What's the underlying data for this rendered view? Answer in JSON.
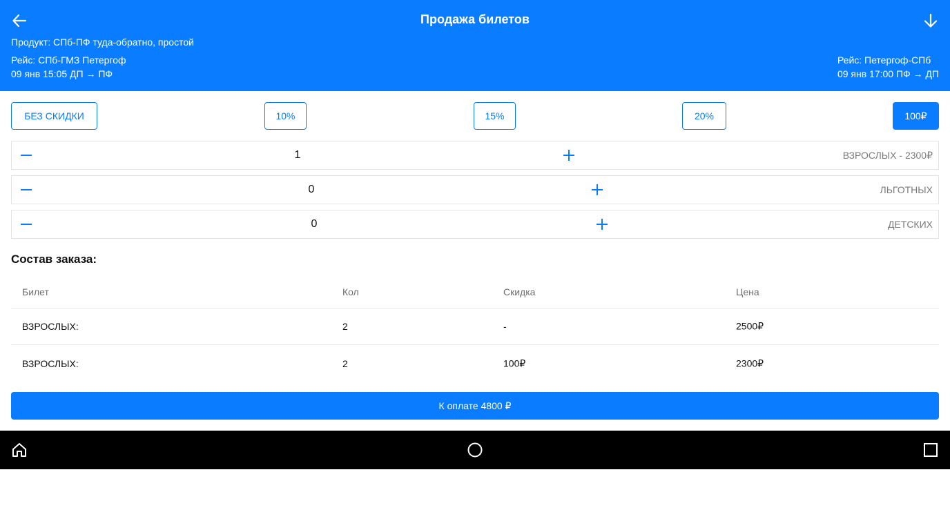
{
  "header": {
    "title": "Продажа билетов",
    "product": "Продукт: СПб-ПФ туда-обратно, простой",
    "outbound": {
      "route": "Рейс: СПб-ГМЗ Петергоф",
      "time": "09 янв 15:05 ДП → ПФ"
    },
    "return": {
      "route": "Рейс: Петергоф-СПб",
      "time": "09 янв 17:00 ПФ → ДП"
    }
  },
  "discounts": [
    {
      "label": "БЕЗ СКИДКИ",
      "active": false
    },
    {
      "label": "10%",
      "active": false
    },
    {
      "label": "15%",
      "active": false
    },
    {
      "label": "20%",
      "active": false
    },
    {
      "label": "100₽",
      "active": true
    }
  ],
  "counters": [
    {
      "value": "1",
      "label": "ВЗРОСЛЫХ - 2300₽"
    },
    {
      "value": "0",
      "label": "ЛЬГОТНЫХ"
    },
    {
      "value": "0",
      "label": "ДЕТСКИХ"
    }
  ],
  "order": {
    "title": "Состав заказа:",
    "columns": [
      "Билет",
      "Кол",
      "Скидка",
      "Цена"
    ],
    "rows": [
      [
        "ВЗРОСЛЫХ:",
        "2",
        "-",
        "2500₽"
      ],
      [
        "ВЗРОСЛЫХ:",
        "2",
        "100₽",
        "2300₽"
      ]
    ]
  },
  "pay_button": "К оплате 4800 ₽",
  "icons": {
    "back": "arrow-left-icon",
    "download": "arrow-down-icon",
    "minus": "minus-icon",
    "plus": "plus-icon",
    "nav_home": "home-icon",
    "nav_circle": "circle-home-icon",
    "nav_square": "recents-square-icon"
  },
  "colors": {
    "accent": "#0a7cff",
    "navbar": "#000000",
    "muted": "#7a7a7a"
  }
}
